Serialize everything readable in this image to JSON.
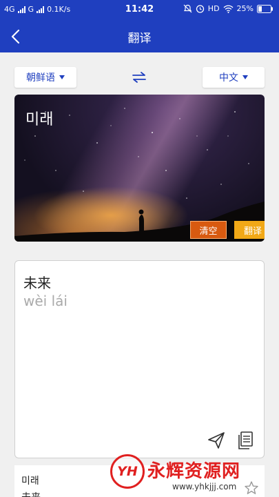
{
  "status": {
    "network": "4G",
    "network2": "G",
    "speed": "0.1K/s",
    "time": "11:42",
    "hd": "HD",
    "battery": "25%"
  },
  "header": {
    "title": "翻译"
  },
  "languages": {
    "source": "朝鲜语",
    "target": "中文"
  },
  "image_card": {
    "ocr_text": "미래",
    "clear_label": "清空",
    "translate_label": "翻译"
  },
  "result": {
    "translation": "未来",
    "pinyin": "wèi lái"
  },
  "history": {
    "source": "미래",
    "target": "未来"
  },
  "watermark": {
    "logo": "YH",
    "text": "永辉资源网",
    "url": "www.yhkjjj.com"
  },
  "colors": {
    "primary": "#1f3fbf",
    "clear": "#d85a10",
    "translate": "#f1a817"
  }
}
